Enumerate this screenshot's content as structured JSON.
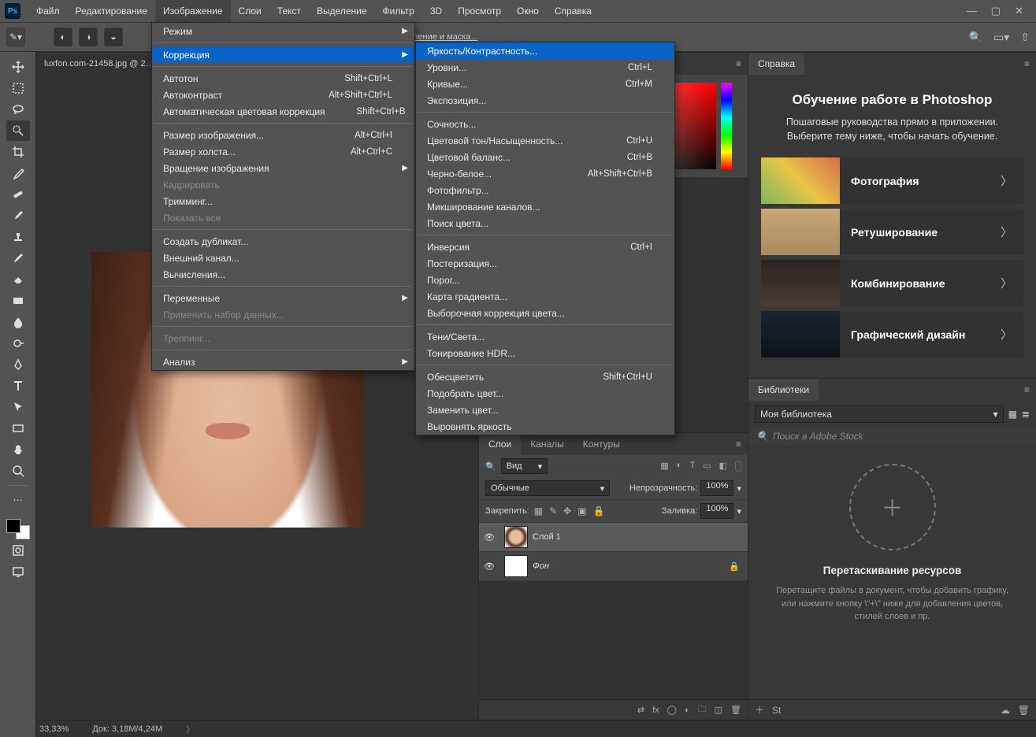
{
  "menu": {
    "items": [
      "Файл",
      "Редактирование",
      "Изображение",
      "Слои",
      "Текст",
      "Выделение",
      "Фильтр",
      "3D",
      "Просмотр",
      "Окно",
      "Справка"
    ],
    "open_index": 2
  },
  "doc_tab": {
    "label": "luxfon.com-21458.jpg @ 2…",
    "close": "×"
  },
  "image_menu": {
    "mode": "Режим",
    "correction": "Коррекция",
    "autotone": "Автотон",
    "autotone_kb": "Shift+Ctrl+L",
    "autocontrast": "Автоконтраст",
    "autocontrast_kb": "Alt+Shift+Ctrl+L",
    "autocolor": "Автоматическая цветовая коррекция",
    "autocolor_kb": "Shift+Ctrl+B",
    "imgsize": "Размер изображения...",
    "imgsize_kb": "Alt+Ctrl+I",
    "canvassize": "Размер холста...",
    "canvassize_kb": "Alt+Ctrl+C",
    "rotate": "Вращение изображения",
    "crop": "Кадрировать",
    "trim": "Тримминг...",
    "reveal": "Показать все",
    "dup": "Создать дубликат...",
    "apply": "Внешний канал...",
    "calc": "Вычисления...",
    "vars": "Переменные",
    "applydata": "Применить набор данных...",
    "trap": "Треппинг...",
    "analysis": "Анализ"
  },
  "adjust_menu": {
    "brightness": "Яркость/Контрастность...",
    "levels": "Уровни...",
    "levels_kb": "Ctrl+L",
    "curves": "Кривые...",
    "curves_kb": "Ctrl+M",
    "exposure": "Экспозиция...",
    "vibrance": "Сочность...",
    "huesat": "Цветовой тон/Насыщенность...",
    "huesat_kb": "Ctrl+U",
    "colorbal": "Цветовой баланс...",
    "colorbal_kb": "Ctrl+B",
    "bw": "Черно-белое...",
    "bw_kb": "Alt+Shift+Ctrl+B",
    "photofilter": "Фотофильтр...",
    "chanmix": "Микширование каналов...",
    "colorlookup": "Поиск цвета...",
    "invert": "Инверсия",
    "invert_kb": "Ctrl+I",
    "posterize": "Постеризация...",
    "threshold": "Порог...",
    "gradmap": "Карта градиента...",
    "selective": "Выборочная коррекция цвета...",
    "shadhi": "Тени/Света...",
    "hdr": "Тонирование HDR...",
    "desat": "Обесцветить",
    "desat_kb": "Shift+Ctrl+U",
    "match": "Подобрать цвет...",
    "replace": "Заменить цвет...",
    "equalize": "Выровнять яркость"
  },
  "optionsbar": {
    "mask_hint": "ление и маска..."
  },
  "help_panel": {
    "tab": "Справка",
    "title": "Обучение работе в Photoshop",
    "subtitle": "Пошаговые руководства прямо в приложении. Выберите тему ниже, чтобы начать обучение.",
    "items": [
      "Фотография",
      "Ретуширование",
      "Комбинирование",
      "Графический дизайн"
    ]
  },
  "libraries": {
    "tab": "Библиотеки",
    "selected": "Моя библиотека",
    "search_ph": "Поиск в Adobe Stock",
    "drop_title": "Перетаскивание ресурсов",
    "drop_text": "Перетащите файлы в документ, чтобы добавить графику, или нажмите кнопку \\\"+\\\" ниже для добавления цветов, стилей слоев и пр."
  },
  "layers_panel": {
    "tabs": [
      "Слои",
      "Каналы",
      "Контуры"
    ],
    "kind": "Вид",
    "blend": "Обычные",
    "opacity_label": "Непрозрачность:",
    "opacity_val": "100%",
    "lock_label": "Закрепить:",
    "fill_label": "Заливка:",
    "fill_val": "100%",
    "layer1": "Слой 1",
    "bg": "Фон"
  },
  "status": {
    "zoom": "33,33%",
    "docinfo": "Док: 3,18M/4,24M"
  }
}
